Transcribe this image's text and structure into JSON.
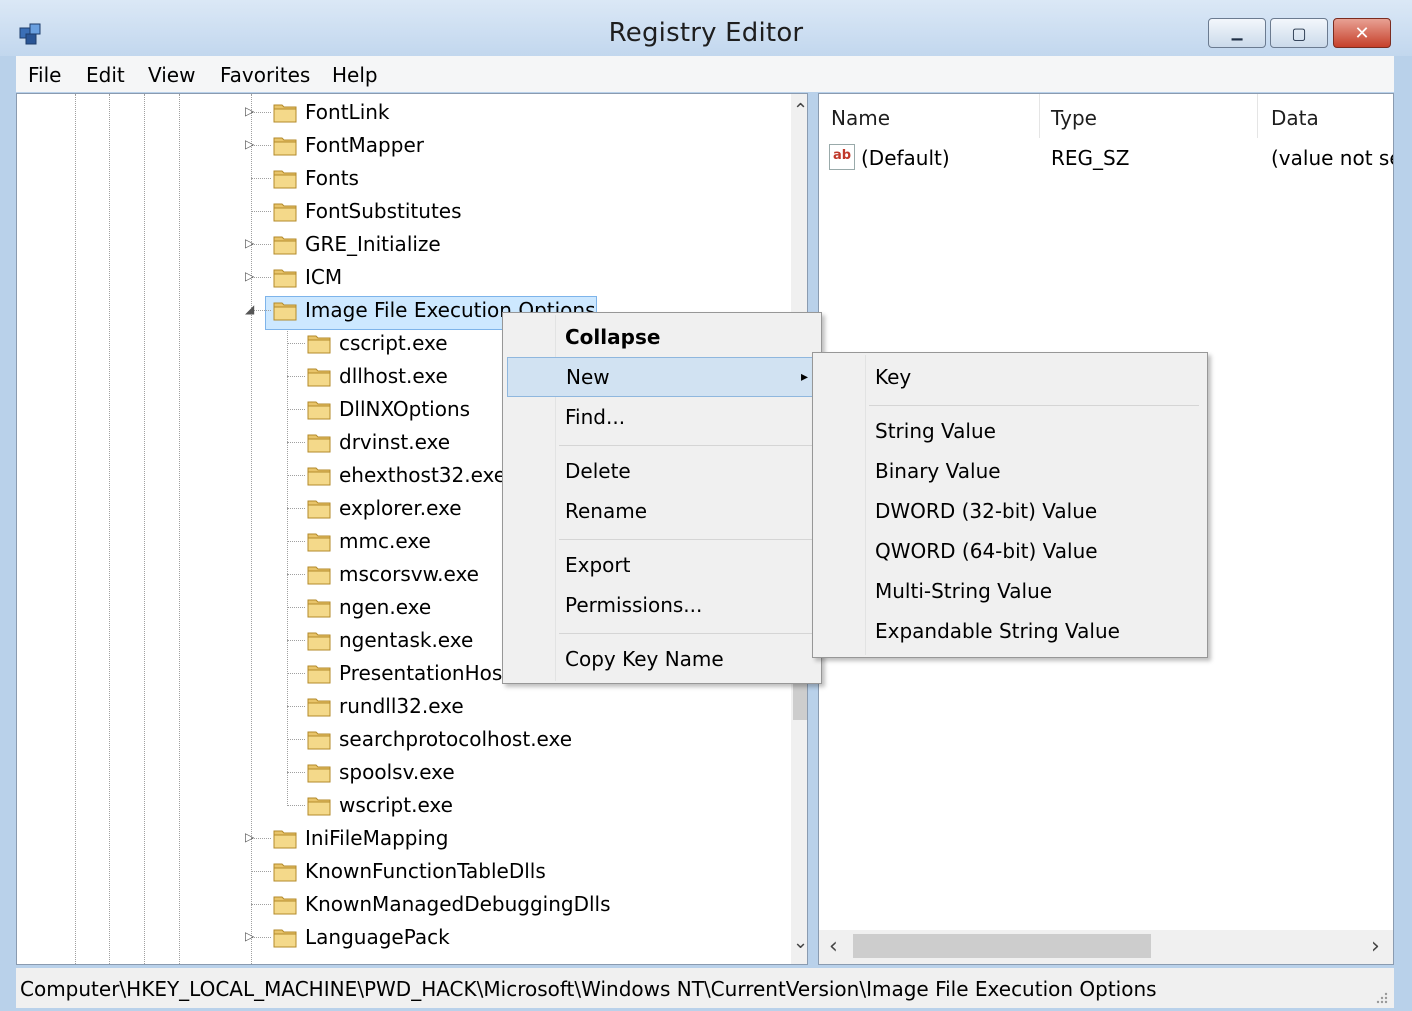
{
  "window": {
    "title": "Registry Editor"
  },
  "menubar": {
    "items": [
      "File",
      "Edit",
      "View",
      "Favorites",
      "Help"
    ]
  },
  "tree": {
    "items": [
      {
        "label": "FontLink",
        "expander": "▷"
      },
      {
        "label": "FontMapper",
        "expander": "▷"
      },
      {
        "label": "Fonts",
        "expander": ""
      },
      {
        "label": "FontSubstitutes",
        "expander": ""
      },
      {
        "label": "GRE_Initialize",
        "expander": "▷"
      },
      {
        "label": "ICM",
        "expander": "▷"
      },
      {
        "label": "Image File Execution Options",
        "expander": "◢"
      },
      {
        "label": "cscript.exe"
      },
      {
        "label": "dllhost.exe"
      },
      {
        "label": "DllNXOptions"
      },
      {
        "label": "drvinst.exe"
      },
      {
        "label": "ehexthost32.exe"
      },
      {
        "label": "explorer.exe"
      },
      {
        "label": "mmc.exe"
      },
      {
        "label": "mscorsvw.exe"
      },
      {
        "label": "ngen.exe"
      },
      {
        "label": "ngentask.exe"
      },
      {
        "label": "PresentationHos"
      },
      {
        "label": "rundll32.exe"
      },
      {
        "label": "searchprotocolhost.exe"
      },
      {
        "label": "spoolsv.exe"
      },
      {
        "label": "wscript.exe"
      },
      {
        "label": "IniFileMapping",
        "expander": "▷"
      },
      {
        "label": "KnownFunctionTableDlls",
        "expander": ""
      },
      {
        "label": "KnownManagedDebuggingDlls",
        "expander": ""
      },
      {
        "label": "LanguagePack",
        "expander": "▷"
      }
    ]
  },
  "list": {
    "columns": [
      "Name",
      "Type",
      "Data"
    ],
    "rows": [
      {
        "icon": "ab",
        "name": "(Default)",
        "type": "REG_SZ",
        "data": "(value not se"
      }
    ]
  },
  "context_menu": {
    "items": [
      "Collapse",
      "New",
      "Find...",
      "Delete",
      "Rename",
      "Export",
      "Permissions...",
      "Copy Key Name"
    ]
  },
  "submenu": {
    "items": [
      "Key",
      "String Value",
      "Binary Value",
      "DWORD (32-bit) Value",
      "QWORD (64-bit) Value",
      "Multi-String Value",
      "Expandable String Value"
    ]
  },
  "statusbar": {
    "path": "Computer\\HKEY_LOCAL_MACHINE\\PWD_HACK\\Microsoft\\Windows NT\\CurrentVersion\\Image File Execution Options"
  },
  "glyphs": {
    "minimize": "▁",
    "maximize": "▢",
    "close": "✕",
    "scroll_up": "⌃",
    "scroll_down": "⌄",
    "scroll_left": "‹",
    "scroll_right": "›",
    "submenu_arrow": "▸"
  },
  "colors": {
    "selection": "#cde8ff",
    "close_button": "#c6402a",
    "menu_highlight": "#d1e2f2"
  }
}
